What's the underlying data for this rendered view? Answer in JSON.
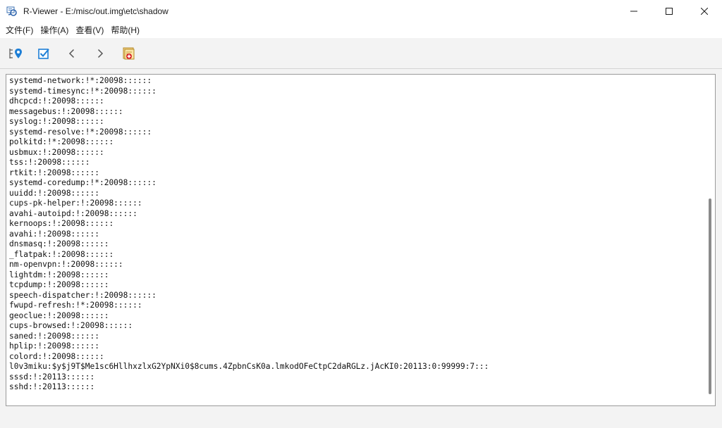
{
  "window": {
    "title": "R-Viewer - E:/misc/out.img\\etc\\shadow",
    "minimize_glyph": "—",
    "maximize_glyph": "☐",
    "close_glyph": "✕"
  },
  "menu": [
    "文件(F)",
    "操作(A)",
    "查看(V)",
    "帮助(H)"
  ],
  "toolbar": {
    "icons": [
      "tree-location-icon",
      "checkbox-icon",
      "chevron-left-icon",
      "chevron-right-icon",
      "recover-files-icon"
    ],
    "accent": "#1e7fd6"
  },
  "lines": [
    "systemd-network:!*:20098::::::",
    "systemd-timesync:!*:20098::::::",
    "dhcpcd:!:20098::::::",
    "messagebus:!:20098::::::",
    "syslog:!:20098::::::",
    "systemd-resolve:!*:20098::::::",
    "polkitd:!*:20098::::::",
    "usbmux:!:20098::::::",
    "tss:!:20098::::::",
    "rtkit:!:20098::::::",
    "systemd-coredump:!*:20098::::::",
    "uuidd:!:20098::::::",
    "cups-pk-helper:!:20098::::::",
    "avahi-autoipd:!:20098::::::",
    "kernoops:!:20098::::::",
    "avahi:!:20098::::::",
    "dnsmasq:!:20098::::::",
    "_flatpak:!:20098::::::",
    "nm-openvpn:!:20098::::::",
    "lightdm:!:20098::::::",
    "tcpdump:!:20098::::::",
    "speech-dispatcher:!:20098::::::",
    "fwupd-refresh:!*:20098::::::",
    "geoclue:!:20098::::::",
    "cups-browsed:!:20098::::::",
    "saned:!:20098::::::",
    "hplip:!:20098::::::",
    "colord:!:20098::::::",
    "l0v3miku:$y$j9T$Me1sc6HllhxzlxG2YpNXi0$8cums.4ZpbnCsK0a.lmkodOFeCtpC2daRGLz.jAcKI0:20113:0:99999:7:::",
    "sssd:!:20113::::::",
    "sshd:!:20113::::::"
  ]
}
